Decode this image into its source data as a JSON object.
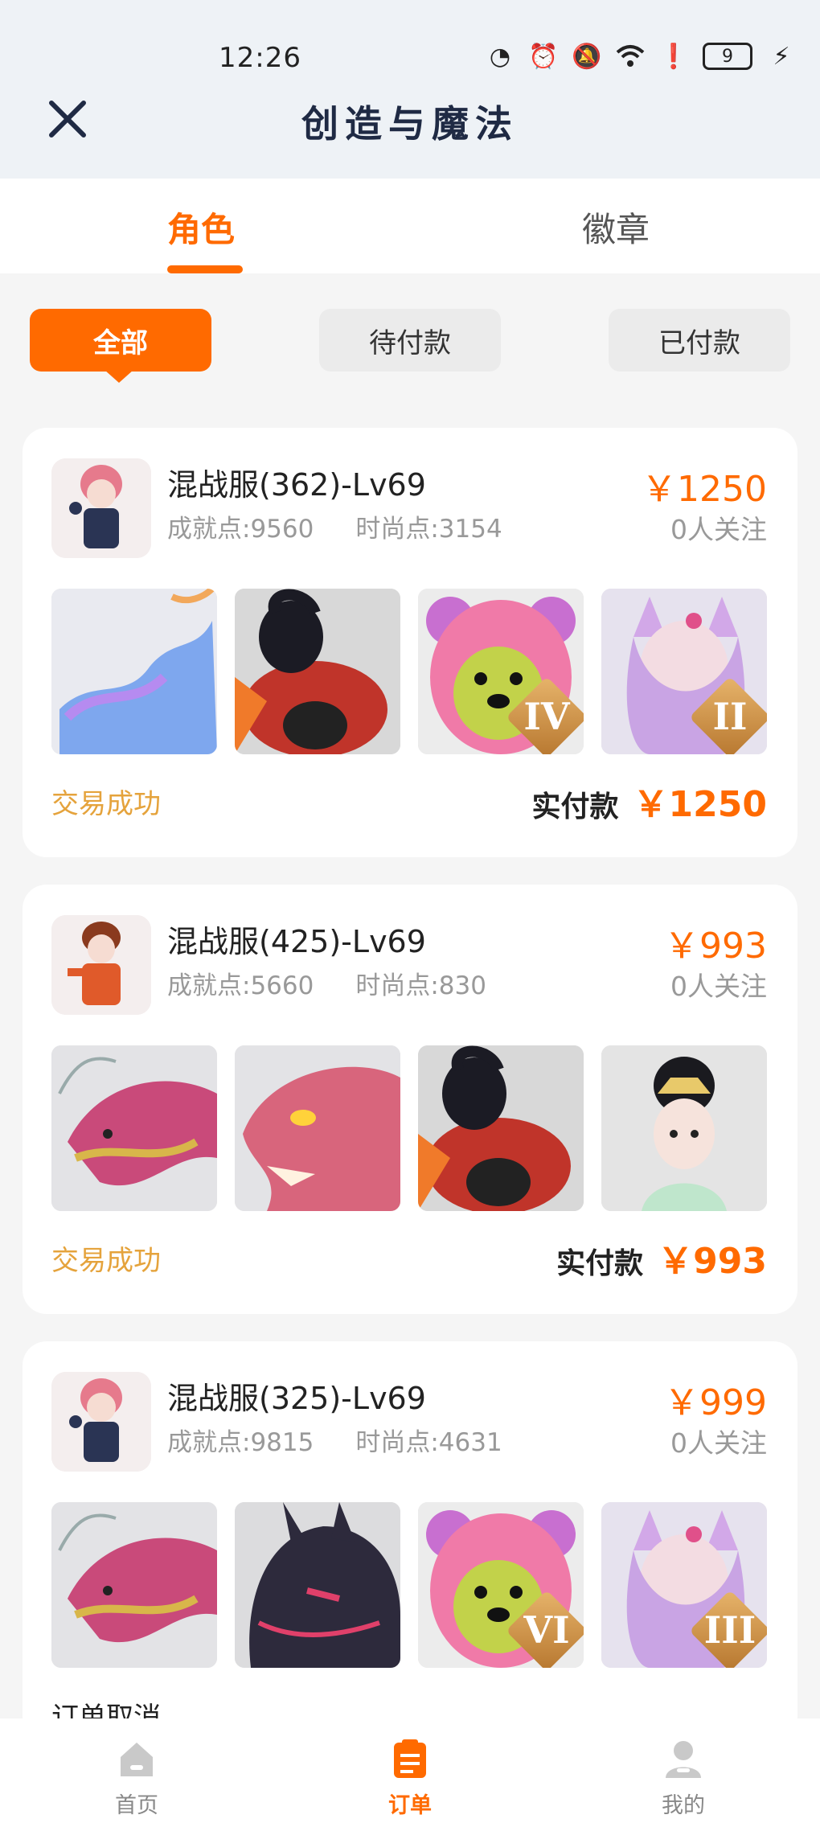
{
  "status_bar": {
    "time": "12:26",
    "battery": "9"
  },
  "header": {
    "title": "创造与魔法"
  },
  "main_tabs": [
    {
      "label": "角色",
      "active": true
    },
    {
      "label": "徽章",
      "active": false
    }
  ],
  "filters": [
    {
      "label": "全部",
      "active": true
    },
    {
      "label": "待付款",
      "active": false
    },
    {
      "label": "已付款",
      "active": false
    }
  ],
  "orders": [
    {
      "server": "混战服(362)-Lv69",
      "achievement": "成就点:9560",
      "fashion": "时尚点:3154",
      "price": "￥1250",
      "followers": "0人关注",
      "thumbs": [
        {
          "icon": "blue-dragon-mount"
        },
        {
          "icon": "black-goat-mount"
        },
        {
          "icon": "pink-bear-pet",
          "badge": "IV"
        },
        {
          "icon": "fox-spirit-pet",
          "badge": "II"
        }
      ],
      "status": "交易成功",
      "paid_label": "实付款",
      "paid_amount": "￥1250"
    },
    {
      "server": "混战服(425)-Lv69",
      "achievement": "成就点:5660",
      "fashion": "时尚点:830",
      "price": "￥993",
      "followers": "0人关注",
      "thumbs": [
        {
          "icon": "red-dragon-mount"
        },
        {
          "icon": "red-dragon-head"
        },
        {
          "icon": "black-goat-mount"
        },
        {
          "icon": "princess-character"
        }
      ],
      "status": "交易成功",
      "paid_label": "实付款",
      "paid_amount": "￥993"
    },
    {
      "server": "混战服(325)-Lv69",
      "achievement": "成就点:9815",
      "fashion": "时尚点:4631",
      "price": "￥999",
      "followers": "0人关注",
      "thumbs": [
        {
          "icon": "red-dragon-mount"
        },
        {
          "icon": "dark-dragon-mount"
        },
        {
          "icon": "pink-bear-pet",
          "badge": "VI"
        },
        {
          "icon": "fox-spirit-pet",
          "badge": "III"
        }
      ],
      "status": "订单取消"
    }
  ],
  "bottom_nav": [
    {
      "label": "首页",
      "icon": "home-icon",
      "active": false
    },
    {
      "label": "订单",
      "icon": "order-icon",
      "active": true
    },
    {
      "label": "我的",
      "icon": "profile-icon",
      "active": false
    }
  ],
  "colors": {
    "accent": "#ff6a00",
    "success": "#e5a33c",
    "header_bg": "#eef2f6"
  }
}
